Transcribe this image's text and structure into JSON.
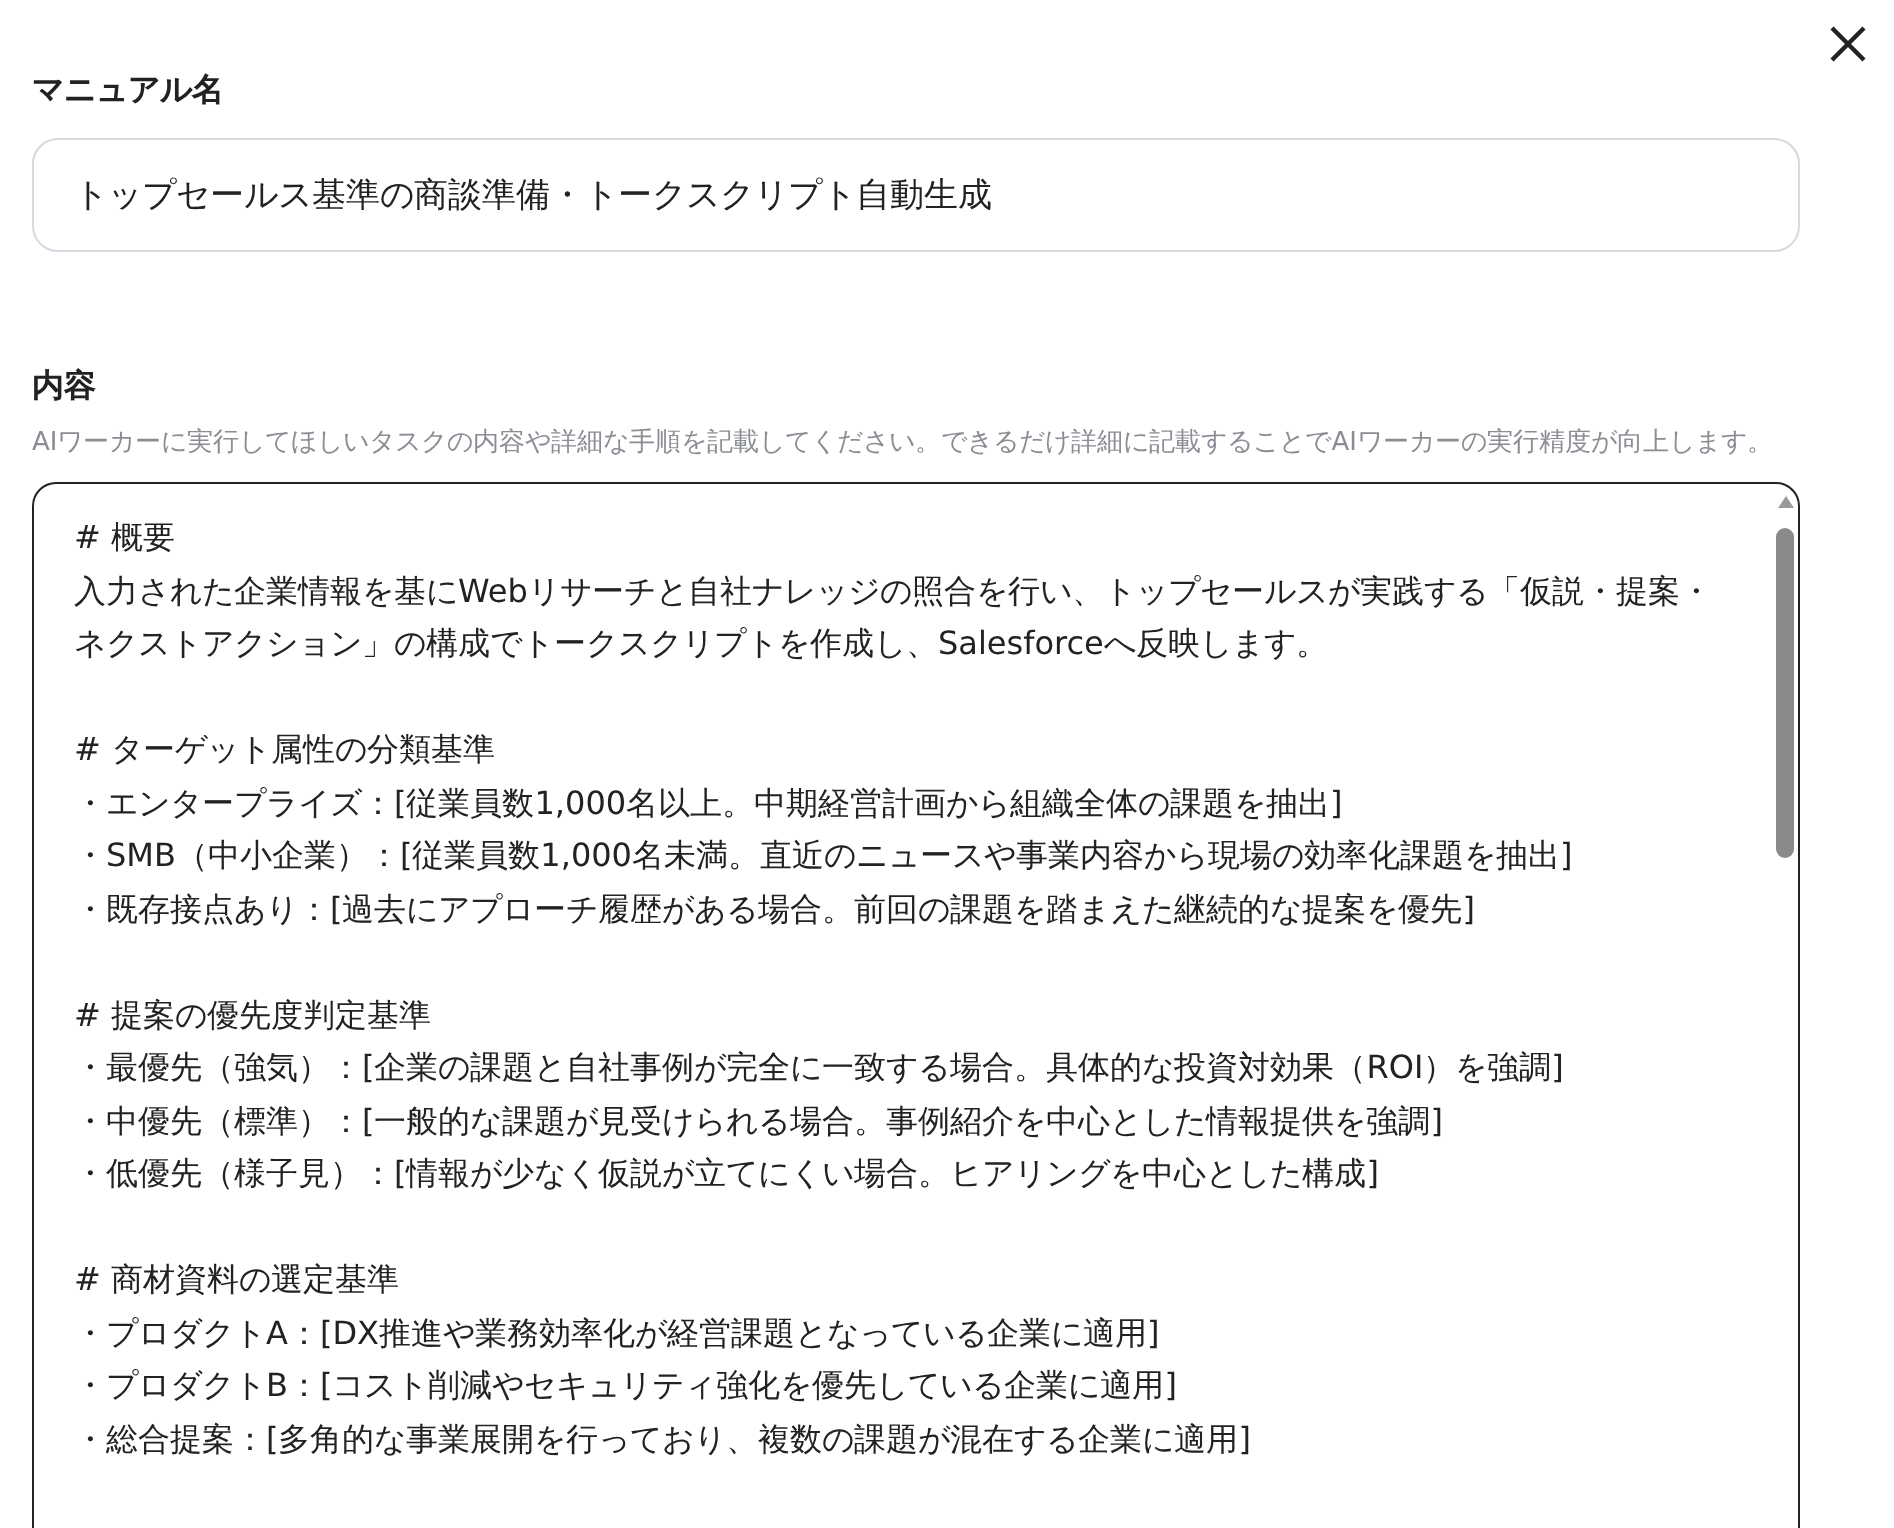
{
  "name_label": "マニュアル名",
  "name_field": {
    "value": "トップセールス基準の商談準備・トークスクリプト自動生成"
  },
  "content_label": "内容",
  "content_help": "AIワーカーに実行してほしいタスクの内容や詳細な手順を記載してください。できるだけ詳細に記載することでAIワーカーの実行精度が向上します。",
  "content_sections": [
    {
      "heading": "# 概要",
      "lines": [
        "入力された企業情報を基にWebリサーチと自社ナレッジの照合を行い、トップセールスが実践する「仮説・提案・ネクストアクション」の構成でトークスクリプトを作成し、Salesforceへ反映します。"
      ]
    },
    {
      "heading": "# ターゲット属性の分類基準",
      "lines": [
        "・エンタープライズ：[従業員数1,000名以上。中期経営計画から組織全体の課題を抽出]",
        "・SMB（中小企業）：[従業員数1,000名未満。直近のニュースや事業内容から現場の効率化課題を抽出]",
        "・既存接点あり：[過去にアプローチ履歴がある場合。前回の課題を踏まえた継続的な提案を優先]"
      ]
    },
    {
      "heading": "# 提案の優先度判定基準",
      "lines": [
        "・最優先（強気）：[企業の課題と自社事例が完全に一致する場合。具体的な投資対効果（ROI）を強調]",
        "・中優先（標準）：[一般的な課題が見受けられる場合。事例紹介を中心とした情報提供を強調]",
        "・低優先（様子見）：[情報が少なく仮説が立てにくい場合。ヒアリングを中心とした構成]"
      ]
    },
    {
      "heading": "# 商材資料の選定基準",
      "lines": [
        "・プロダクトA：[DX推進や業務効率化が経営課題となっている企業に適用]",
        "・プロダクトB：[コスト削減やセキュリティ強化を優先している企業に適用]",
        "・総合提案：[多角的な事業展開を行っており、複数の課題が混在する企業に適用]"
      ]
    }
  ]
}
